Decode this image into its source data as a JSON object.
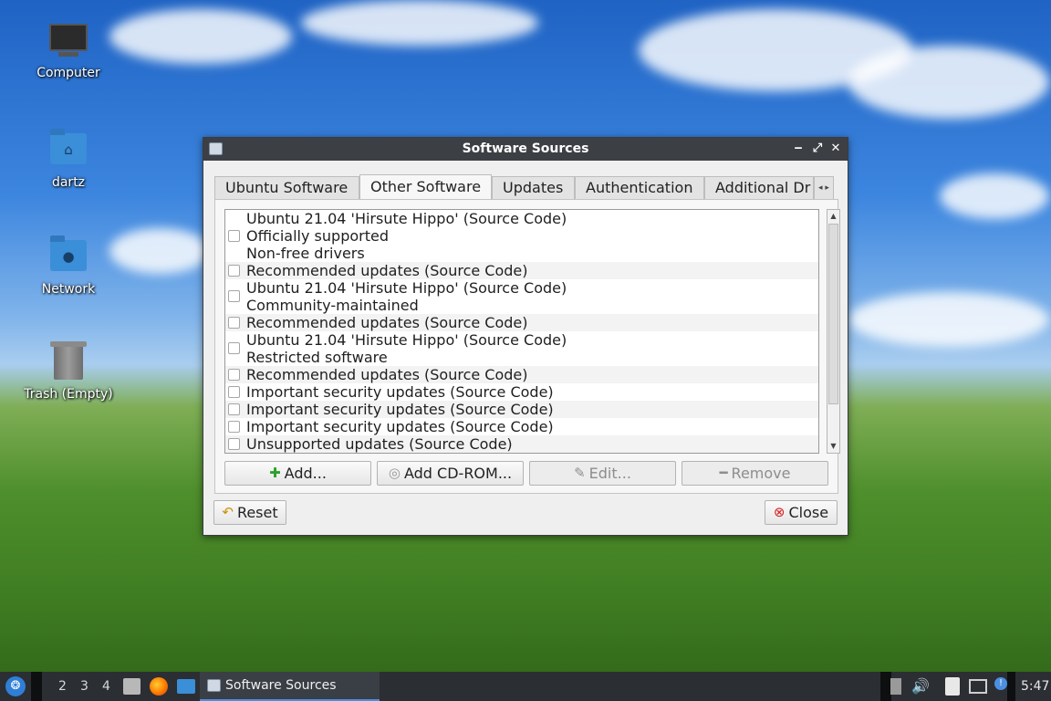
{
  "desktop": {
    "icons": [
      {
        "label": "Computer"
      },
      {
        "label": "dartz"
      },
      {
        "label": "Network"
      },
      {
        "label": "Trash (Empty)"
      }
    ]
  },
  "window": {
    "title": "Software Sources",
    "controls": {
      "minimize": "‒",
      "maximize": "⤢",
      "close": "✕"
    },
    "tabs": [
      {
        "label": "Ubuntu Software",
        "active": false
      },
      {
        "label": "Other Software",
        "active": true
      },
      {
        "label": "Updates",
        "active": false
      },
      {
        "label": "Authentication",
        "active": false
      },
      {
        "label": "Additional Dr",
        "active": false
      }
    ],
    "list_rows": [
      "Ubuntu 21.04 'Hirsute Hippo' (Source Code)",
      "Officially supported",
      "Non-free drivers",
      "Recommended updates (Source Code)",
      "Ubuntu 21.04 'Hirsute Hippo' (Source Code)",
      "Community-maintained",
      "Recommended updates (Source Code)",
      "Ubuntu 21.04 'Hirsute Hippo' (Source Code)",
      "Restricted software",
      "Recommended updates (Source Code)",
      "Important security updates (Source Code)",
      "Important security updates (Source Code)",
      "Important security updates (Source Code)",
      "Unsupported updates (Source Code)"
    ],
    "buttons": {
      "add": "Add...",
      "add_cdrom": "Add CD-ROM...",
      "edit": "Edit...",
      "remove": "Remove",
      "reset": "Reset",
      "close": "Close"
    }
  },
  "taskbar": {
    "workspaces": [
      "2",
      "3",
      "4"
    ],
    "task_label": "Software Sources",
    "clock": "5:47"
  },
  "colors": {
    "titlebar": "#3c3f44",
    "taskbar": "#2b2e33",
    "accent": "#4c8fe0"
  }
}
